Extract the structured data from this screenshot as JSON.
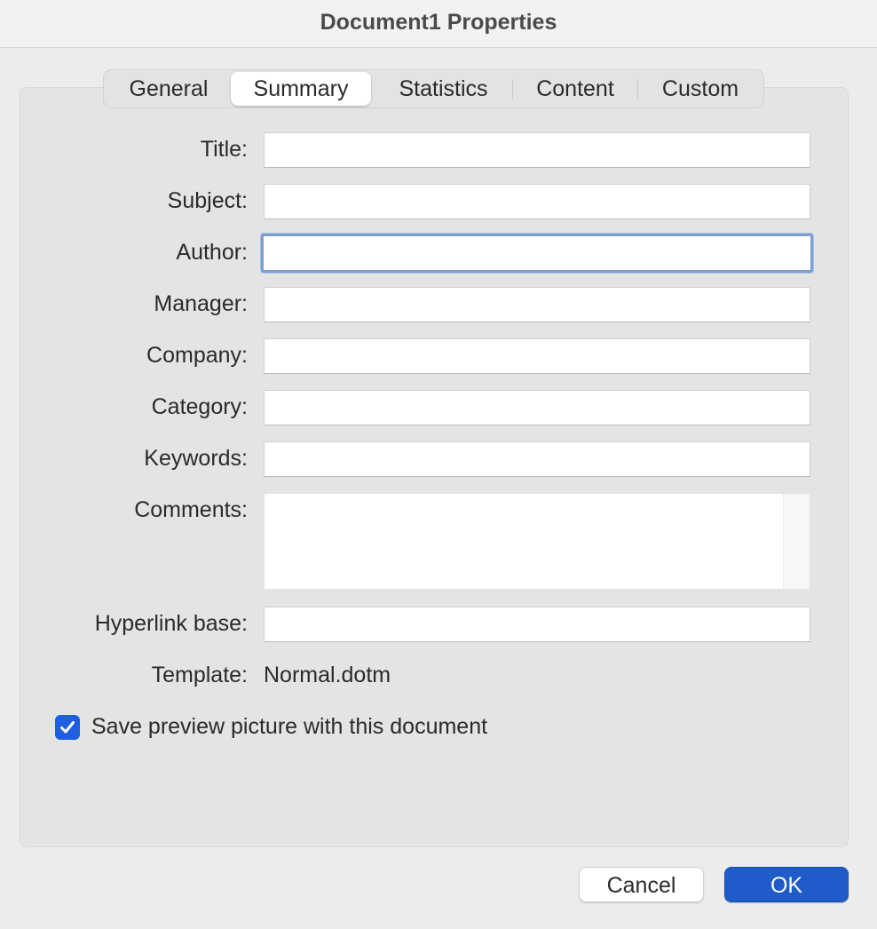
{
  "window": {
    "title": "Document1 Properties"
  },
  "tabs": [
    {
      "label": "General",
      "active": false
    },
    {
      "label": "Summary",
      "active": true
    },
    {
      "label": "Statistics",
      "active": false
    },
    {
      "label": "Content",
      "active": false
    },
    {
      "label": "Custom",
      "active": false
    }
  ],
  "fields": {
    "title": {
      "label": "Title:",
      "value": ""
    },
    "subject": {
      "label": "Subject:",
      "value": ""
    },
    "author": {
      "label": "Author:",
      "value": "",
      "focused": true
    },
    "manager": {
      "label": "Manager:",
      "value": ""
    },
    "company": {
      "label": "Company:",
      "value": ""
    },
    "category": {
      "label": "Category:",
      "value": ""
    },
    "keywords": {
      "label": "Keywords:",
      "value": ""
    },
    "comments": {
      "label": "Comments:",
      "value": ""
    },
    "hyperlink_base": {
      "label": "Hyperlink base:",
      "value": ""
    },
    "template": {
      "label": "Template:",
      "value": "Normal.dotm"
    }
  },
  "save_preview": {
    "label": "Save preview picture with this document",
    "checked": true
  },
  "buttons": {
    "cancel": "Cancel",
    "ok": "OK"
  },
  "colors": {
    "accent": "#1f5bc9",
    "checkbox": "#1d5fe0",
    "focus_ring": "#7f9fd2",
    "panel_bg": "#e4e4e4",
    "window_bg": "#ececec"
  },
  "icons": {
    "checkbox_mark": "checkmark-icon"
  }
}
